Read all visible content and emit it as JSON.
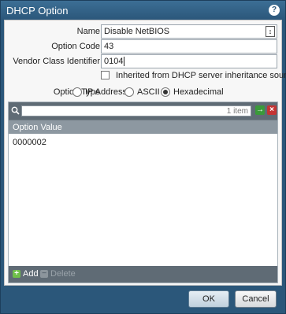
{
  "window": {
    "title": "DHCP Option",
    "help_glyph": "?"
  },
  "form": {
    "name_label": "Name",
    "name_value": "Disable NetBIOS",
    "option_code_label": "Option Code",
    "option_code_value": "43",
    "vendor_class_label": "Vendor Class Identifier",
    "vendor_class_value": "0104",
    "inherit_label": "Inherited from DHCP server inheritance source",
    "inherit_checked": false,
    "option_type_label": "Option Type",
    "option_types": [
      "IP Address",
      "ASCII",
      "Hexadecimal"
    ],
    "option_type_selected": "Hexadecimal"
  },
  "grid": {
    "search_placeholder": "",
    "item_count": "1 item",
    "column_header": "Option Value",
    "rows": [
      "0000002"
    ],
    "add_label": "Add",
    "delete_label": "Delete"
  },
  "buttons": {
    "ok": "OK",
    "cancel": "Cancel"
  },
  "icons": {
    "help": "help-icon",
    "search": "search-icon",
    "go": "arrow-right-icon",
    "clear": "clear-icon",
    "add": "plus-icon",
    "delete": "minus-icon",
    "variable": "variable-tool-icon"
  },
  "colors": {
    "titlebar": "#2b577a",
    "toolbar": "#5f6b75",
    "header": "#8d98a1"
  }
}
